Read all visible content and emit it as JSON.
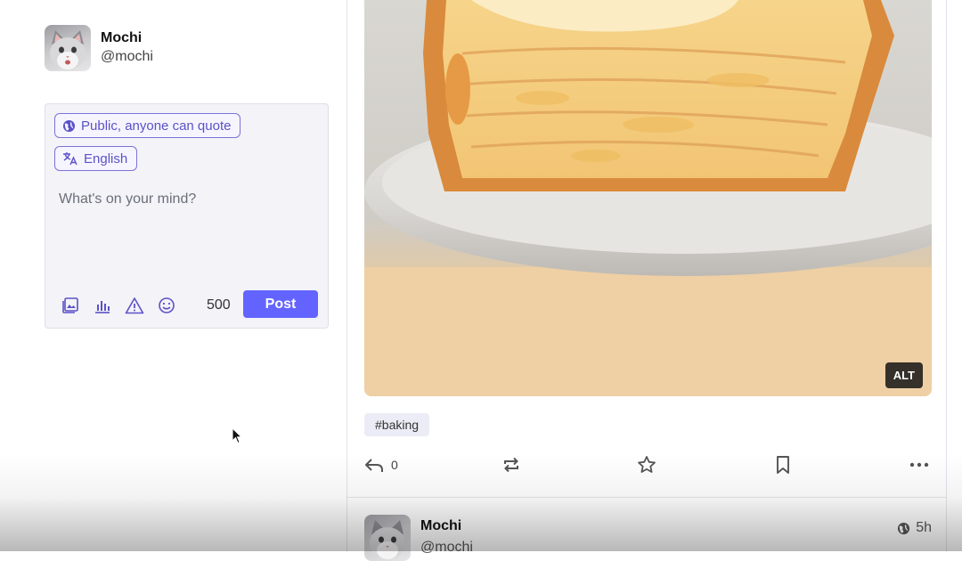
{
  "account": {
    "name": "Mochi",
    "handle": "@mochi"
  },
  "compose": {
    "privacy_label": "Public, anyone can quote",
    "language_label": "English",
    "placeholder": "What's on your mind?",
    "char_count": "500",
    "post_label": "Post",
    "tools": [
      "media-icon",
      "poll-icon",
      "content-warning-icon",
      "emoji-icon"
    ],
    "accent": "#6364ff"
  },
  "feed": {
    "media_alt_badge": "ALT",
    "hashtag": "#baking",
    "reply_count": "0",
    "next_post": {
      "name": "Mochi",
      "handle": "@mochi",
      "time": "5h"
    }
  }
}
